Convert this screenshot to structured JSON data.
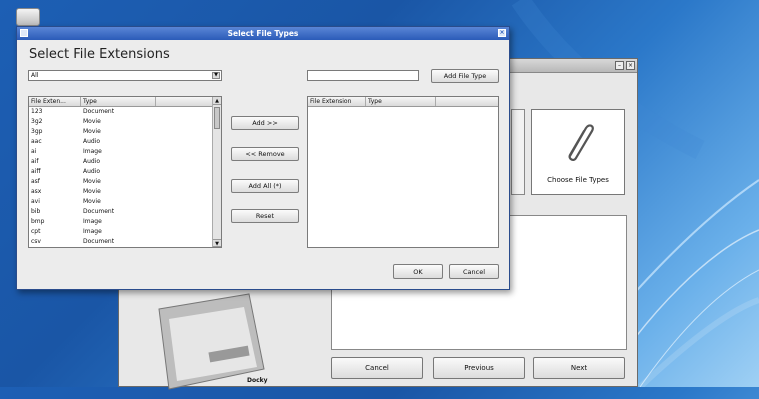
{
  "desktop": {
    "icon": "drive-icon"
  },
  "background_window": {
    "choose_label": "Choose File Types",
    "dock_label": "Docky",
    "buttons": {
      "cancel": "Cancel",
      "previous": "Previous",
      "next": "Next"
    }
  },
  "dialog": {
    "title": "Select File Types",
    "heading": "Select File Extensions",
    "filter_value": "All",
    "type_input_value": "",
    "add_file_type_label": "Add File Type",
    "available_headers": [
      "File Exten...",
      "Type"
    ],
    "available_rows": [
      [
        "123",
        "Document"
      ],
      [
        "3g2",
        "Movie"
      ],
      [
        "3gp",
        "Movie"
      ],
      [
        "aac",
        "Audio"
      ],
      [
        "ai",
        "Image"
      ],
      [
        "aif",
        "Audio"
      ],
      [
        "aiff",
        "Audio"
      ],
      [
        "asf",
        "Movie"
      ],
      [
        "asx",
        "Movie"
      ],
      [
        "avi",
        "Movie"
      ],
      [
        "bib",
        "Document"
      ],
      [
        "bmp",
        "Image"
      ],
      [
        "cpt",
        "Image"
      ],
      [
        "csv",
        "Document"
      ]
    ],
    "selected_headers": [
      "File Extension",
      "Type"
    ],
    "selected_rows": [],
    "add_label": "Add >>",
    "remove_label": "<< Remove",
    "add_all_label": "Add All (*)",
    "reset_label": "Reset",
    "ok_label": "OK",
    "cancel_label": "Cancel"
  },
  "colors": {
    "titlebar": "#2b5bb8",
    "desktop": "#1d5fb4"
  }
}
